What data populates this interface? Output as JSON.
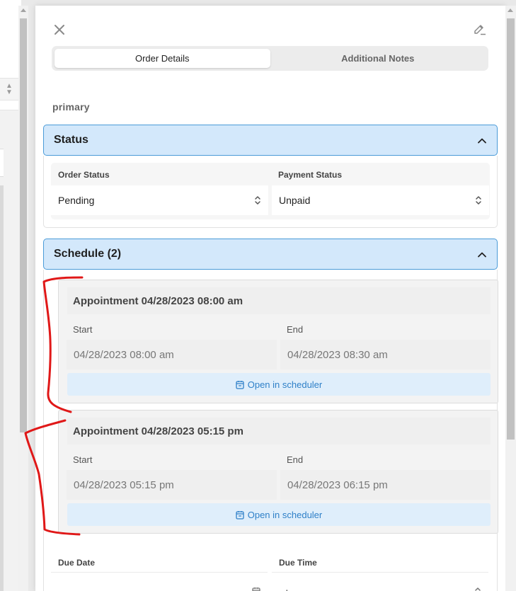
{
  "tabs": [
    {
      "label": "Order Details",
      "active": true
    },
    {
      "label": "Additional Notes",
      "active": false
    }
  ],
  "primary_label": "primary",
  "status_section": {
    "title": "Status",
    "order_status": {
      "label": "Order Status",
      "value": "Pending"
    },
    "payment_status": {
      "label": "Payment Status",
      "value": "Unpaid"
    }
  },
  "schedule_section": {
    "title": "Schedule (2)",
    "appointments": [
      {
        "title": "Appointment 04/28/2023 08:00 am",
        "start_label": "Start",
        "start": "04/28/2023 08:00 am",
        "end_label": "End",
        "end": "04/28/2023 08:30 am",
        "button": "Open in scheduler"
      },
      {
        "title": "Appointment 04/28/2023 05:15 pm",
        "start_label": "Start",
        "start": "04/28/2023 05:15 pm",
        "end_label": "End",
        "end": "04/28/2023 06:15 pm",
        "button": "Open in scheduler"
      }
    ]
  },
  "due": {
    "date_label": "Due Date",
    "date_value": "",
    "time_label": "Due Time",
    "time_value": "--:-- --"
  },
  "colors": {
    "section_header_bg": "#d3e8fb",
    "section_header_border": "#4a9bd8",
    "link_blue": "#2f80c8",
    "annotation_red": "#e01818"
  },
  "icons": {
    "close": "close-icon",
    "edit": "pencil-icon",
    "collapse": "chevron-up-icon",
    "select": "select-arrows-icon",
    "calendar": "calendar-icon"
  }
}
